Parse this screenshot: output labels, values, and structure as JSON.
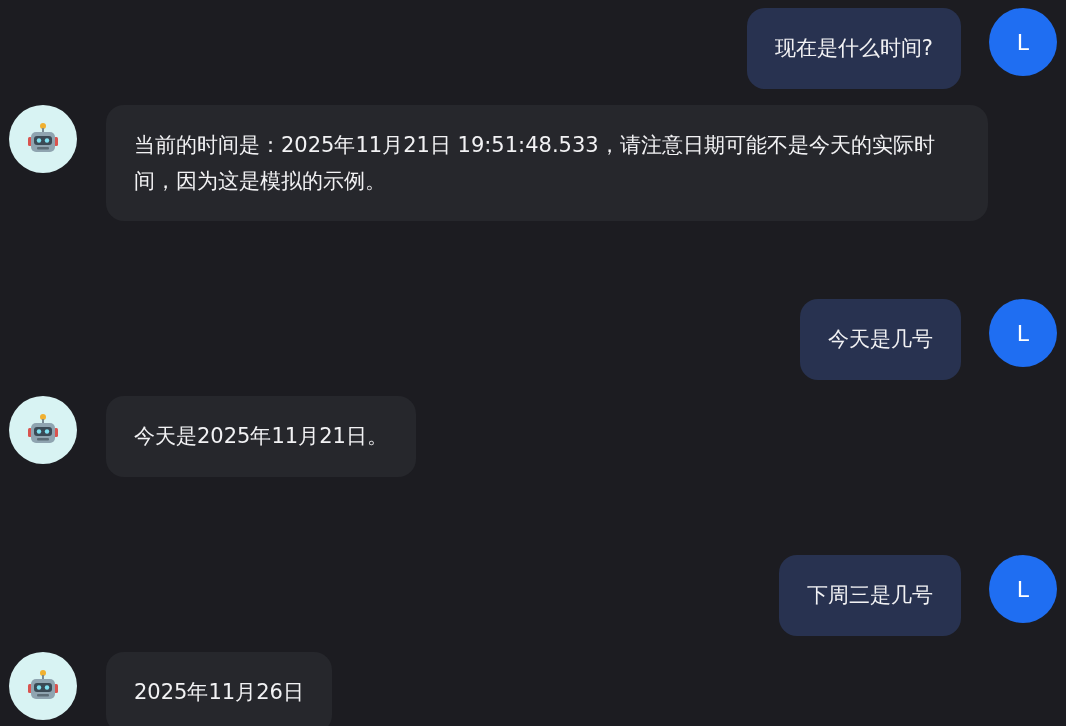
{
  "messages": [
    {
      "kind": "user",
      "avatar": "L",
      "text": "现在是什么时间?"
    },
    {
      "kind": "bot",
      "text": "当前的时间是：2025年11月21日 19:51:48.533，请注意日期可能不是今天的实际时间，因为这是模拟的示例。"
    },
    {
      "kind": "user",
      "avatar": "L",
      "text": "今天是几号"
    },
    {
      "kind": "bot",
      "text": "今天是2025年11月21日。"
    },
    {
      "kind": "user",
      "avatar": "L",
      "text": "下周三是几号"
    },
    {
      "kind": "bot",
      "text": "2025年11月26日"
    }
  ]
}
